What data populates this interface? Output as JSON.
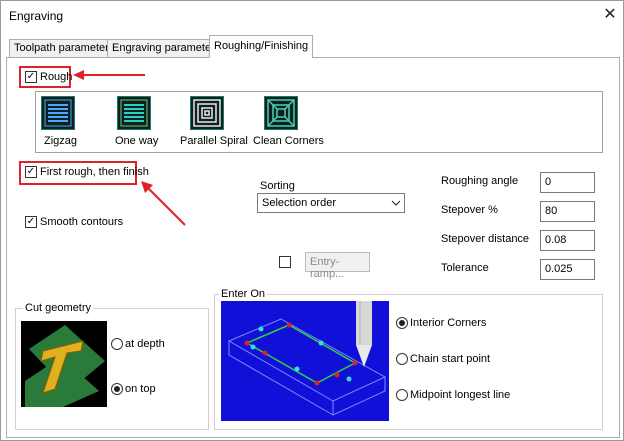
{
  "window": {
    "title": "Engraving",
    "close_glyph": "✕"
  },
  "tabs": [
    {
      "label": "Toolpath parameters",
      "active": false
    },
    {
      "label": "Engraving parameters",
      "active": false
    },
    {
      "label": "Roughing/Finishing",
      "active": true
    }
  ],
  "rough": {
    "label": "Rough",
    "checked": true
  },
  "tools": [
    {
      "label": "Zigzag",
      "icon": "zigzag-icon"
    },
    {
      "label": "One way",
      "icon": "one-way-icon"
    },
    {
      "label": "Parallel Spiral",
      "icon": "parallel-spiral-icon"
    },
    {
      "label": "Clean Corners",
      "icon": "clean-corners-icon"
    }
  ],
  "first_rough": {
    "label": "First rough, then finish",
    "checked": true
  },
  "smooth": {
    "label": "Smooth contours",
    "checked": true
  },
  "sorting": {
    "label": "Sorting",
    "value": "Selection order"
  },
  "entry_ramp": {
    "label": "Entry-ramp...",
    "checked": false
  },
  "params": [
    {
      "label": "Roughing angle",
      "value": "0"
    },
    {
      "label": "Stepover %",
      "value": "80"
    },
    {
      "label": "Stepover distance",
      "value": "0.08"
    },
    {
      "label": "Tolerance",
      "value": "0.025"
    }
  ],
  "cut_geometry": {
    "title": "Cut geometry",
    "options": [
      {
        "label": "at depth",
        "selected": false
      },
      {
        "label": "on top",
        "selected": true
      }
    ]
  },
  "enter_on": {
    "title": "Enter On",
    "options": [
      {
        "label": "Interior Corners",
        "selected": true
      },
      {
        "label": "Chain start point",
        "selected": false
      },
      {
        "label": "Midpoint longest line",
        "selected": false
      }
    ]
  },
  "colors": {
    "annotation_red": "#e0202a",
    "tool_icon_teal": "#1a7a70",
    "preview_blue": "#1010d8",
    "cut_green": "#2a7a3a"
  }
}
